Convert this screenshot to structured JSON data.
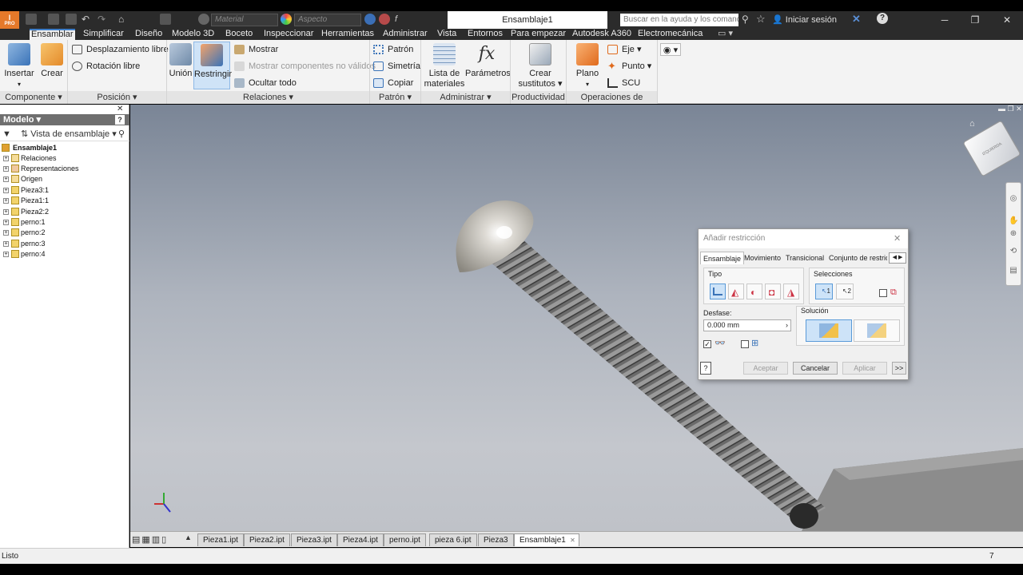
{
  "app": {
    "doc_title": "Ensamblaje1",
    "logo_label": "PRO"
  },
  "quick_access": {
    "material_placeholder": "Material",
    "appearance_placeholder": "Aspecto"
  },
  "help_search": {
    "placeholder": "Buscar en la ayuda y los comandos"
  },
  "user": {
    "login_label": "Iniciar sesión"
  },
  "ribbon_tabs": [
    "Ensamblar",
    "Simplificar",
    "Diseño",
    "Modelo 3D",
    "Boceto",
    "Inspeccionar",
    "Herramientas",
    "Administrar",
    "Vista",
    "Entornos",
    "Para empezar",
    "Autodesk A360",
    "Electromecánica"
  ],
  "ribbon": {
    "componente": {
      "label": "Componente",
      "insertar": "Insertar",
      "crear": "Crear"
    },
    "posicion": {
      "label": "Posición",
      "desplazamiento": "Desplazamiento libre",
      "rotacion": "Rotación libre"
    },
    "relaciones": {
      "label": "Relaciones",
      "union": "Unión",
      "restringir": "Restringir",
      "mostrar": "Mostrar",
      "mostrar_no_validos": "Mostrar componentes no válidos",
      "ocultar": "Ocultar todo"
    },
    "patron": {
      "label": "Patrón",
      "patron": "Patrón",
      "simetria": "Simetría",
      "copiar": "Copiar"
    },
    "administrar": {
      "label": "Administrar",
      "lista": "Lista de materiales",
      "parametros": "Parámetros"
    },
    "productividad": {
      "label": "Productividad",
      "crear_sustitutos": "Crear sustitutos"
    },
    "operaciones": {
      "label": "Operaciones de trabajo",
      "plano": "Plano",
      "eje": "Eje",
      "punto": "Punto",
      "scu": "SCU"
    }
  },
  "model_panel": {
    "title": "Modelo",
    "view_label": "Vista de ensamblaje",
    "root": "Ensamblaje1",
    "items": [
      "Relaciones",
      "Representaciones",
      "Origen",
      "Pieza3:1",
      "Pieza1:1",
      "Pieza2:2",
      "perno:1",
      "perno:2",
      "perno:3",
      "perno:4"
    ]
  },
  "doc_tabs": [
    "Pieza1.ipt",
    "Pieza2.ipt",
    "Pieza3.ipt",
    "Pieza4.ipt",
    "perno.ipt",
    "pieza 6.ipt",
    "Pieza3",
    "Ensamblaje1"
  ],
  "status": {
    "text": "Listo",
    "count": "7"
  },
  "dialog": {
    "title": "Añadir restricción",
    "tabs": [
      "Ensamblaje",
      "Movimiento",
      "Transicional",
      "Conjunto de restric"
    ],
    "tipo_label": "Tipo",
    "selecciones_label": "Selecciones",
    "sel1": "1",
    "sel2": "2",
    "desfase_label": "Desfase:",
    "desfase_value": "0.000 mm",
    "solucion_label": "Solución",
    "aceptar": "Aceptar",
    "cancelar": "Cancelar",
    "aplicar": "Aplicar",
    "more": ">>"
  },
  "viewcube": {
    "face_label": "IZQUIERDA"
  },
  "colors": {
    "accent": "#3d7ec9",
    "ribbon_bg": "#f3f3f3",
    "title_bg": "#2b2b2b",
    "viewport_top": "#7a8596"
  }
}
